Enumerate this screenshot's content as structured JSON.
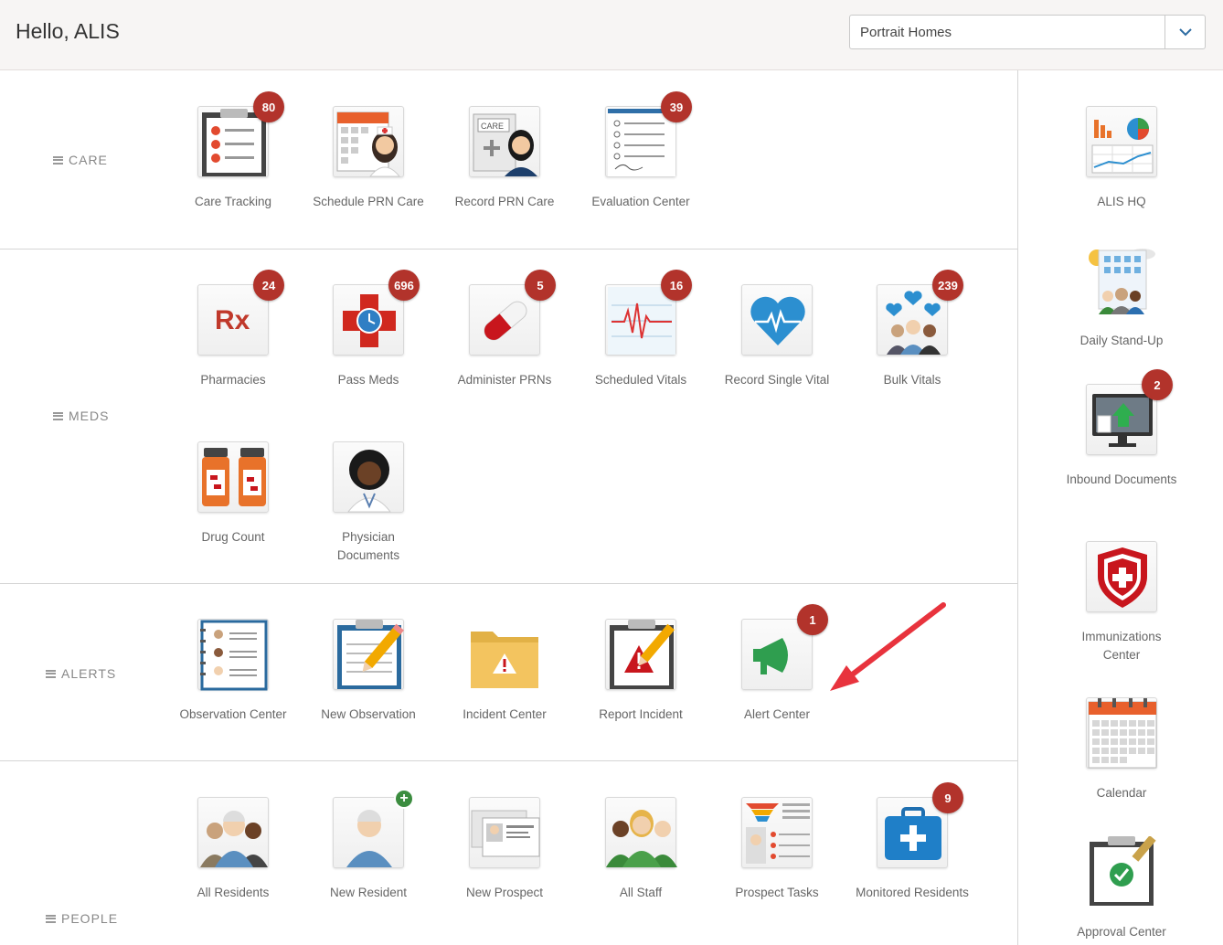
{
  "header": {
    "greeting": "Hello, ALIS",
    "facility_select": {
      "value": "Portrait Homes"
    }
  },
  "sections": {
    "care": {
      "label": "CARE"
    },
    "meds": {
      "label": "MEDS"
    },
    "alerts": {
      "label": "ALERTS"
    },
    "people": {
      "label": "PEOPLE"
    }
  },
  "care": [
    {
      "label": "Care Tracking",
      "badge": "80",
      "icon": "clipboard-checklist-icon"
    },
    {
      "label": "Schedule PRN Care",
      "badge": null,
      "icon": "nurse-calendar-icon"
    },
    {
      "label": "Record PRN Care",
      "badge": null,
      "icon": "care-plus-icon"
    },
    {
      "label": "Evaluation Center",
      "badge": "39",
      "icon": "evaluation-form-icon"
    }
  ],
  "meds": [
    {
      "label": "Pharmacies",
      "badge": "24",
      "icon": "rx-icon"
    },
    {
      "label": "Pass Meds",
      "badge": "696",
      "icon": "medical-cross-clock-icon"
    },
    {
      "label": "Administer PRNs",
      "badge": "5",
      "icon": "pill-capsule-icon"
    },
    {
      "label": "Scheduled Vitals",
      "badge": "16",
      "icon": "ecg-chart-icon"
    },
    {
      "label": "Record Single Vital",
      "badge": null,
      "icon": "heart-pulse-icon"
    },
    {
      "label": "Bulk Vitals",
      "badge": "239",
      "icon": "people-hearts-icon"
    },
    {
      "label": "Drug Count",
      "badge": null,
      "icon": "pill-bottles-icon"
    },
    {
      "label": "Physician Documents",
      "badge": null,
      "icon": "physician-icon"
    }
  ],
  "alerts": [
    {
      "label": "Observation Center",
      "badge": null,
      "icon": "observation-notebook-icon"
    },
    {
      "label": "New Observation",
      "badge": null,
      "icon": "clipboard-pencil-icon"
    },
    {
      "label": "Incident Center",
      "badge": null,
      "icon": "warning-folder-icon"
    },
    {
      "label": "Report Incident",
      "badge": null,
      "icon": "clipboard-warning-icon"
    },
    {
      "label": "Alert Center",
      "badge": "1",
      "icon": "megaphone-icon"
    }
  ],
  "people": [
    {
      "label": "All Residents",
      "badge": null,
      "icon": "residents-group-icon"
    },
    {
      "label": "New Resident",
      "badge": "+",
      "icon": "resident-add-icon"
    },
    {
      "label": "New Prospect",
      "badge": null,
      "icon": "prospect-card-icon"
    },
    {
      "label": "All Staff",
      "badge": null,
      "icon": "staff-group-icon"
    },
    {
      "label": "Prospect Tasks",
      "badge": null,
      "icon": "funnel-tasks-icon"
    },
    {
      "label": "Monitored Residents",
      "badge": "9",
      "icon": "medical-kit-icon"
    }
  ],
  "sidebar": [
    {
      "label": "ALIS HQ",
      "badge": null,
      "icon": "dashboard-charts-icon"
    },
    {
      "label": "Daily Stand-Up",
      "badge": null,
      "icon": "building-people-icon"
    },
    {
      "label": "Inbound Documents",
      "badge": "2",
      "icon": "monitor-upload-icon"
    },
    {
      "label": "Immunizations Center",
      "badge": null,
      "icon": "shield-cross-icon"
    },
    {
      "label": "Calendar",
      "badge": null,
      "icon": "calendar-icon"
    },
    {
      "label": "Approval Center",
      "badge": null,
      "icon": "clipboard-approve-icon"
    }
  ],
  "colors": {
    "badge": "#b2332b",
    "annotation_arrow": "#e8333d",
    "header_bg": "#f7f5f4",
    "plus_badge": "#3b8c3f"
  }
}
